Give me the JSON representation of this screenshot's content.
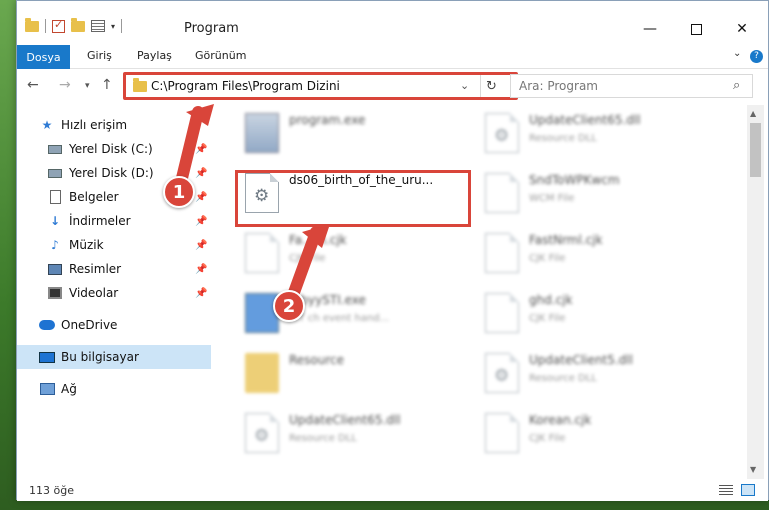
{
  "window": {
    "title": "Program"
  },
  "ribbon": {
    "tabs": [
      "Dosya",
      "Giriş",
      "Paylaş",
      "Görünüm"
    ]
  },
  "navigation": {
    "address": "C:\\Program Files\\Program Dizini",
    "search_placeholder": "Ara: Program"
  },
  "sidebar": {
    "items": [
      {
        "label": "Hızlı erişim",
        "icon": "star-icon"
      },
      {
        "label": "Yerel Disk (C:)",
        "icon": "drive-icon",
        "pinned": true
      },
      {
        "label": "Yerel Disk (D:)",
        "icon": "drive-icon",
        "pinned": true
      },
      {
        "label": "Belgeler",
        "icon": "documents-icon",
        "pinned": true
      },
      {
        "label": "İndirmeler",
        "icon": "download-icon",
        "pinned": true
      },
      {
        "label": "Müzik",
        "icon": "music-icon",
        "pinned": true
      },
      {
        "label": "Resimler",
        "icon": "pictures-icon",
        "pinned": true
      },
      {
        "label": "Videolar",
        "icon": "videos-icon",
        "pinned": true
      },
      {
        "label": "OneDrive",
        "icon": "cloud-icon"
      },
      {
        "label": "Bu bilgisayar",
        "icon": "computer-icon",
        "selected": true
      },
      {
        "label": "Ağ",
        "icon": "network-icon"
      }
    ]
  },
  "files": [
    {
      "name": "program.exe",
      "type": ""
    },
    {
      "name": "UpdateClient65.dll",
      "type": "Resource DLL"
    },
    {
      "name": "ds06_birth_of_the_uru...",
      "type": ""
    },
    {
      "name": "SndToWPKwcm",
      "type": "WCM File"
    },
    {
      "name": "Fa...rn.cjk",
      "type": "CJK File"
    },
    {
      "name": "FastNrml.cjk",
      "type": "CJK File"
    },
    {
      "name": "...byySTI.exe",
      "type": "...T ch event hand..."
    },
    {
      "name": "ghd.cjk",
      "type": "CJK File"
    },
    {
      "name": "Resource",
      "type": ""
    },
    {
      "name": "UpdateClient5.dll",
      "type": "Resource DLL"
    },
    {
      "name": "UpdateClient65.dll",
      "type": "Resource DLL"
    },
    {
      "name": "Korean.cjk",
      "type": "CJK File"
    }
  ],
  "status": {
    "count": "113 öğe"
  },
  "callouts": [
    "1",
    "2"
  ],
  "accent_color": "#1979ca",
  "highlight_color": "#d9453a"
}
